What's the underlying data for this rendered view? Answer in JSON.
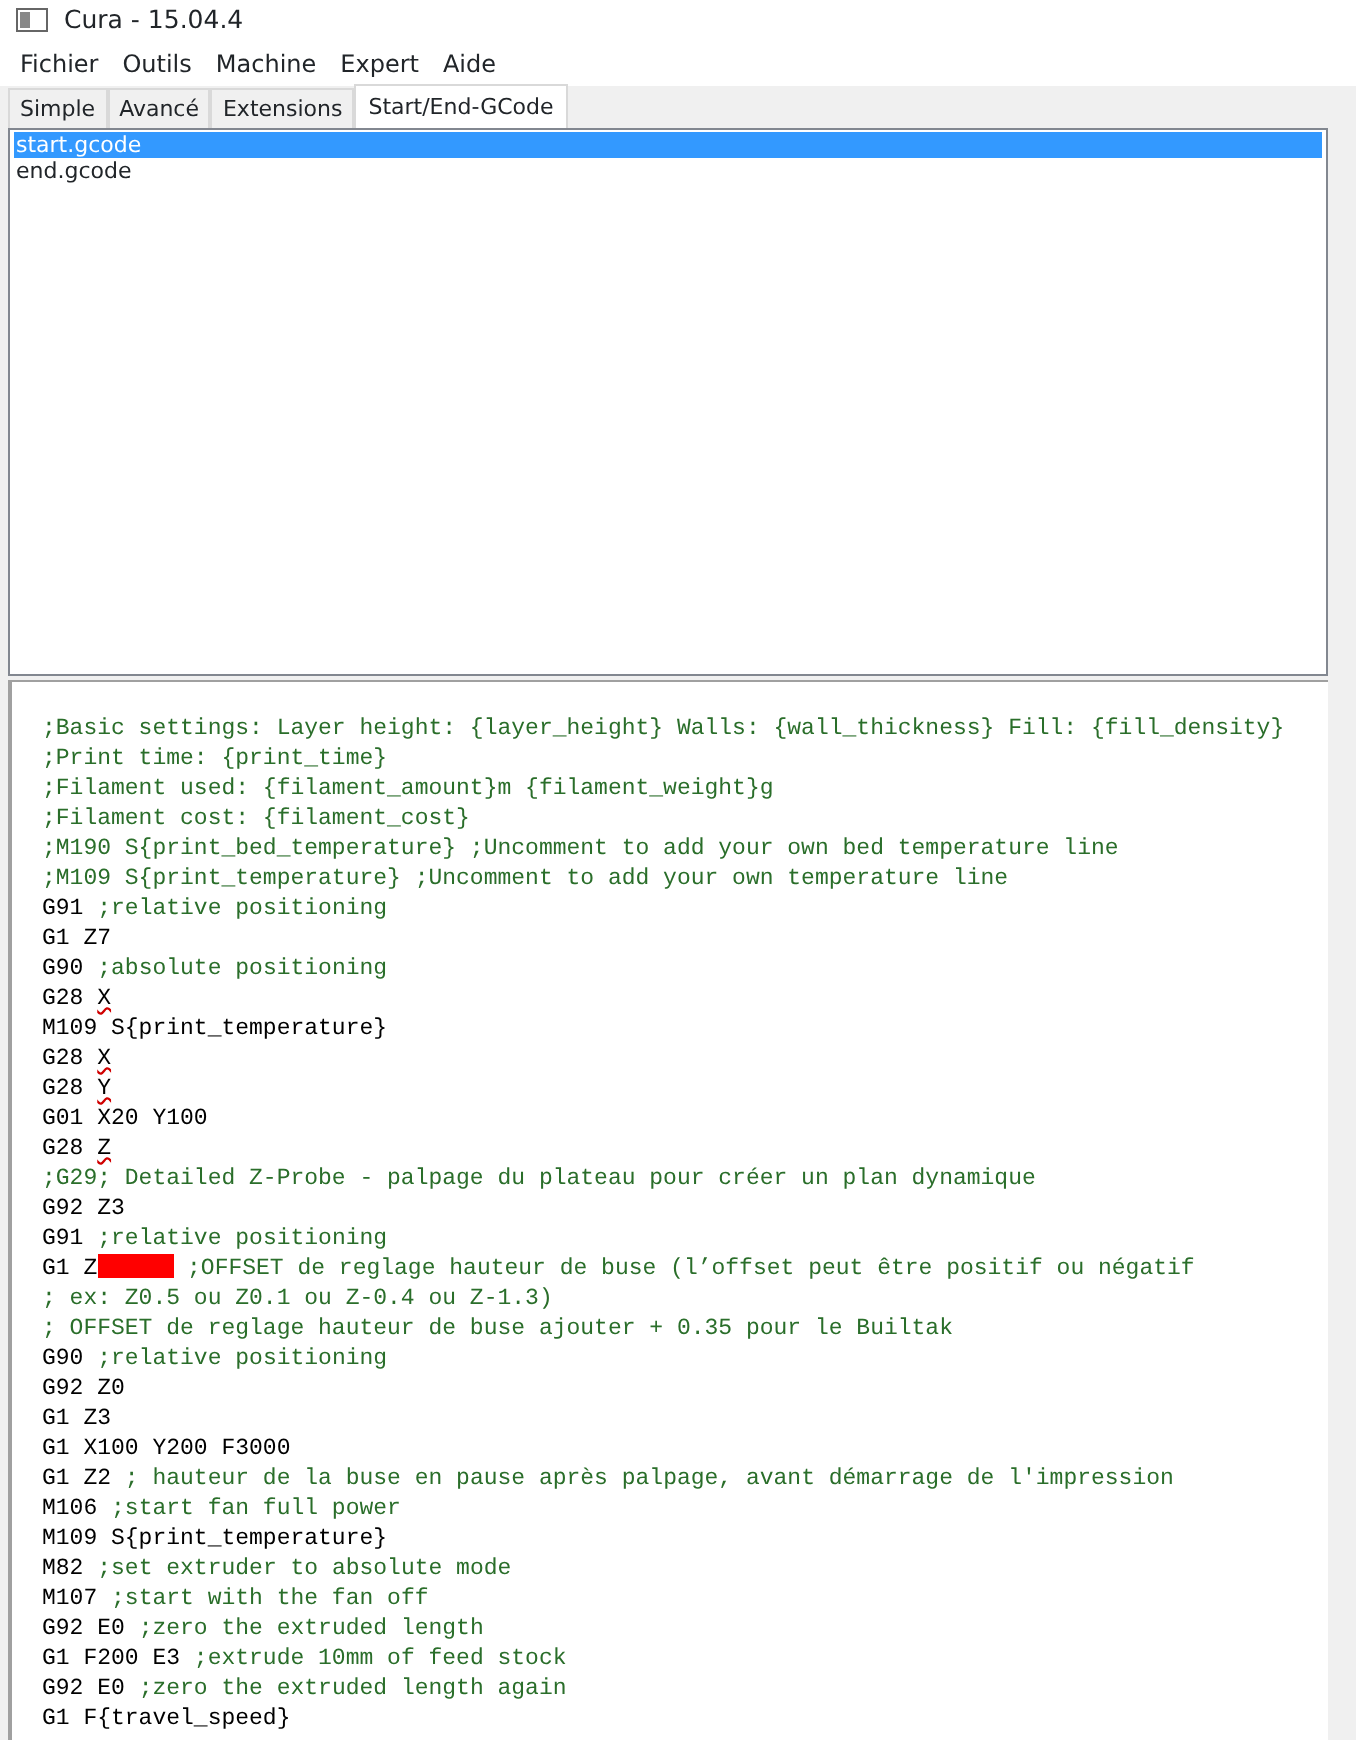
{
  "window": {
    "title": "Cura - 15.04.4"
  },
  "menu": [
    "Fichier",
    "Outils",
    "Machine",
    "Expert",
    "Aide"
  ],
  "tabs": [
    {
      "label": "Simple",
      "selected": false
    },
    {
      "label": "Avancé",
      "selected": false
    },
    {
      "label": "Extensions",
      "selected": false
    },
    {
      "label": "Start/End-GCode",
      "selected": true
    }
  ],
  "files": [
    {
      "label": "start.gcode",
      "selected": true
    },
    {
      "label": "end.gcode",
      "selected": false
    }
  ],
  "editor_lines": [
    {
      "comment": ";Basic settings: Layer height: {layer_height} Walls: {wall_thickness} Fill: {fill_density}"
    },
    {
      "comment": ";Print time: {print_time}"
    },
    {
      "comment": ";Filament used: {filament_amount}m {filament_weight}g"
    },
    {
      "comment": ";Filament cost: {filament_cost}"
    },
    {
      "comment": ";M190 S{print_bed_temperature} ;Uncomment to add your own bed temperature line"
    },
    {
      "comment": ";M109 S{print_temperature} ;Uncomment to add your own temperature line"
    },
    {
      "code": "G91",
      "comment": ";relative positioning"
    },
    {
      "code": "G1 Z7"
    },
    {
      "code": "G90",
      "comment": ";absolute positioning"
    },
    {
      "code": "G28",
      "flagged": "X"
    },
    {
      "code": "M109 S{print_temperature}"
    },
    {
      "code": "G28",
      "flagged": "X"
    },
    {
      "code": "G28",
      "flagged": "Y"
    },
    {
      "code": "G01 X20 Y100"
    },
    {
      "code": "G28",
      "flagged": "Z"
    },
    {
      "comment": ";G29; Detailed Z-Probe - palpage du plateau pour créer un plan dynamique"
    },
    {
      "code": "G92 Z3"
    },
    {
      "code": "G91",
      "comment": ";relative positioning"
    },
    {
      "code": "G1 Z",
      "redacted": true,
      "comment": ";OFFSET de reglage hauteur de buse (l’offset peut être positif ou négatif"
    },
    {
      "comment": "; ex: Z0.5 ou Z0.1 ou Z-0.4 ou Z-1.3)"
    },
    {
      "comment": "; OFFSET de reglage hauteur de buse ajouter + 0.35 pour le Builtak"
    },
    {
      "code": "G90",
      "comment": ";relative positioning"
    },
    {
      "code": "G92 Z0"
    },
    {
      "code": "G1 Z3"
    },
    {
      "code": "G1 X100 Y200 F3000"
    },
    {
      "code": "G1 Z2",
      "comment": "; hauteur de la buse en pause après palpage, avant démarrage de l'impression"
    },
    {
      "code": "M106",
      "comment": ";start fan full power"
    },
    {
      "code": "M109 S{print_temperature}"
    },
    {
      "code": "M82",
      "comment": ";set extruder to absolute mode"
    },
    {
      "code": "M107",
      "comment": ";start with the fan off"
    },
    {
      "code": "G92 E0",
      "comment": ";zero the extruded length"
    },
    {
      "code": "G1 F200 E3",
      "comment": ";extrude 10mm of feed stock"
    },
    {
      "code": "G92 E0",
      "comment": ";zero the extruded length again"
    },
    {
      "code": "G1 F{travel_speed}"
    }
  ]
}
